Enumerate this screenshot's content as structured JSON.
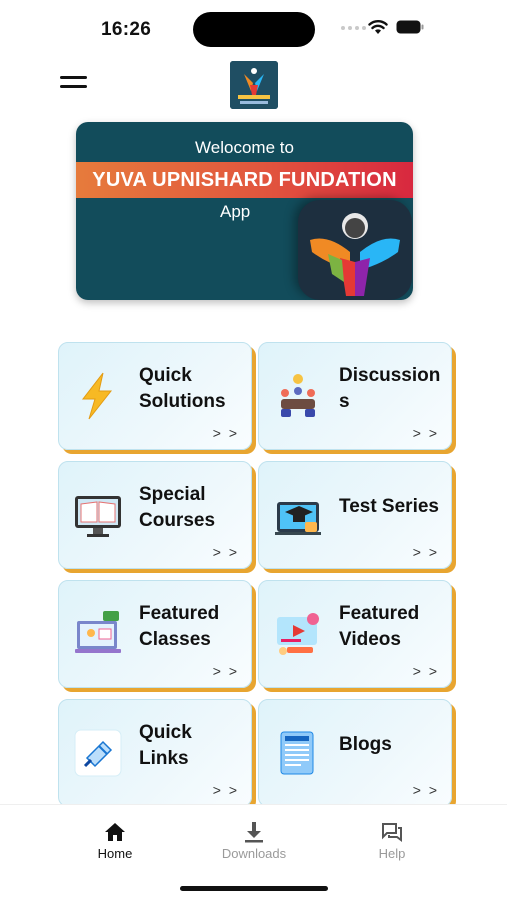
{
  "status": {
    "time": "16:26"
  },
  "header": {
    "menu_icon": "hamburger-icon",
    "logo": "yuva-logo"
  },
  "banner": {
    "welcome": "Welocome to",
    "title": "YUVA UPNISHARD FUNDATION",
    "suffix": "App",
    "colors": {
      "background": "#124c5b",
      "strip": "#e2563e"
    }
  },
  "cards": [
    {
      "label_1": "Quick",
      "label_2": "Solutions",
      "icon": "lightning-icon",
      "arrows": "> >"
    },
    {
      "label_1": "Discussion",
      "label_2": "s",
      "icon": "discussion-icon",
      "arrows": "> >"
    },
    {
      "label_1": "Special",
      "label_2": "Courses",
      "icon": "courses-icon",
      "arrows": "> >"
    },
    {
      "label_1": "Test Series",
      "icon": "test-series-icon",
      "arrows": "> >"
    },
    {
      "label_1": "Featured",
      "label_2": "Classes",
      "icon": "classes-icon",
      "arrows": "> >"
    },
    {
      "label_1": "Featured",
      "label_2": "Videos",
      "icon": "videos-icon",
      "arrows": "> >"
    },
    {
      "label_1": "Quick",
      "label_2": "Links",
      "icon": "links-icon",
      "arrows": "> >"
    },
    {
      "label_1": "Blogs",
      "icon": "blog-icon",
      "arrows": "> >"
    }
  ],
  "tabs": [
    {
      "label": "Home",
      "icon": "home-icon",
      "active": true
    },
    {
      "label": "Downloads",
      "icon": "download-icon",
      "active": false
    },
    {
      "label": "Help",
      "icon": "help-chat-icon",
      "active": false
    }
  ],
  "colors": {
    "card_shadow": "#e8a530",
    "card_bg": "#e6f5fb"
  }
}
